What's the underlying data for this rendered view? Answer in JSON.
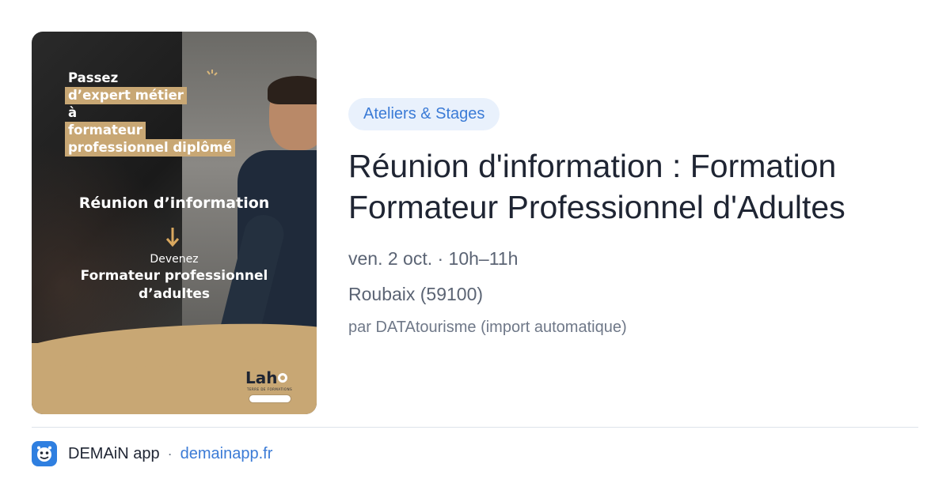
{
  "poster": {
    "headline_line1": "Passez",
    "headline_line2": "d’expert métier",
    "headline_line3": "à",
    "headline_line4": "formateur",
    "headline_line5": "professionnel diplômé",
    "meeting": "Réunion d’information",
    "become": "Devenez",
    "become_line1": "Formateur professionnel",
    "become_line2": "d’adultes",
    "logo_text": "Lah",
    "logo_sub": "TERRE DE FORMATIONS"
  },
  "event": {
    "category": "Ateliers & Stages",
    "title": "Réunion d'information : Formation Formateur Professionnel d'Adultes",
    "datetime": "ven. 2 oct. · 10h–11h",
    "location": "Roubaix (59100)",
    "source": "par DATAtourisme (import automatique)"
  },
  "footer": {
    "app_name": "DEMAiN app",
    "separator": "·",
    "domain": "demainapp.fr",
    "icon": "app-logo-icon"
  },
  "colors": {
    "accent": "#3b7bd6",
    "badge_bg": "#e9f1fc",
    "gold": "#c8a774"
  }
}
